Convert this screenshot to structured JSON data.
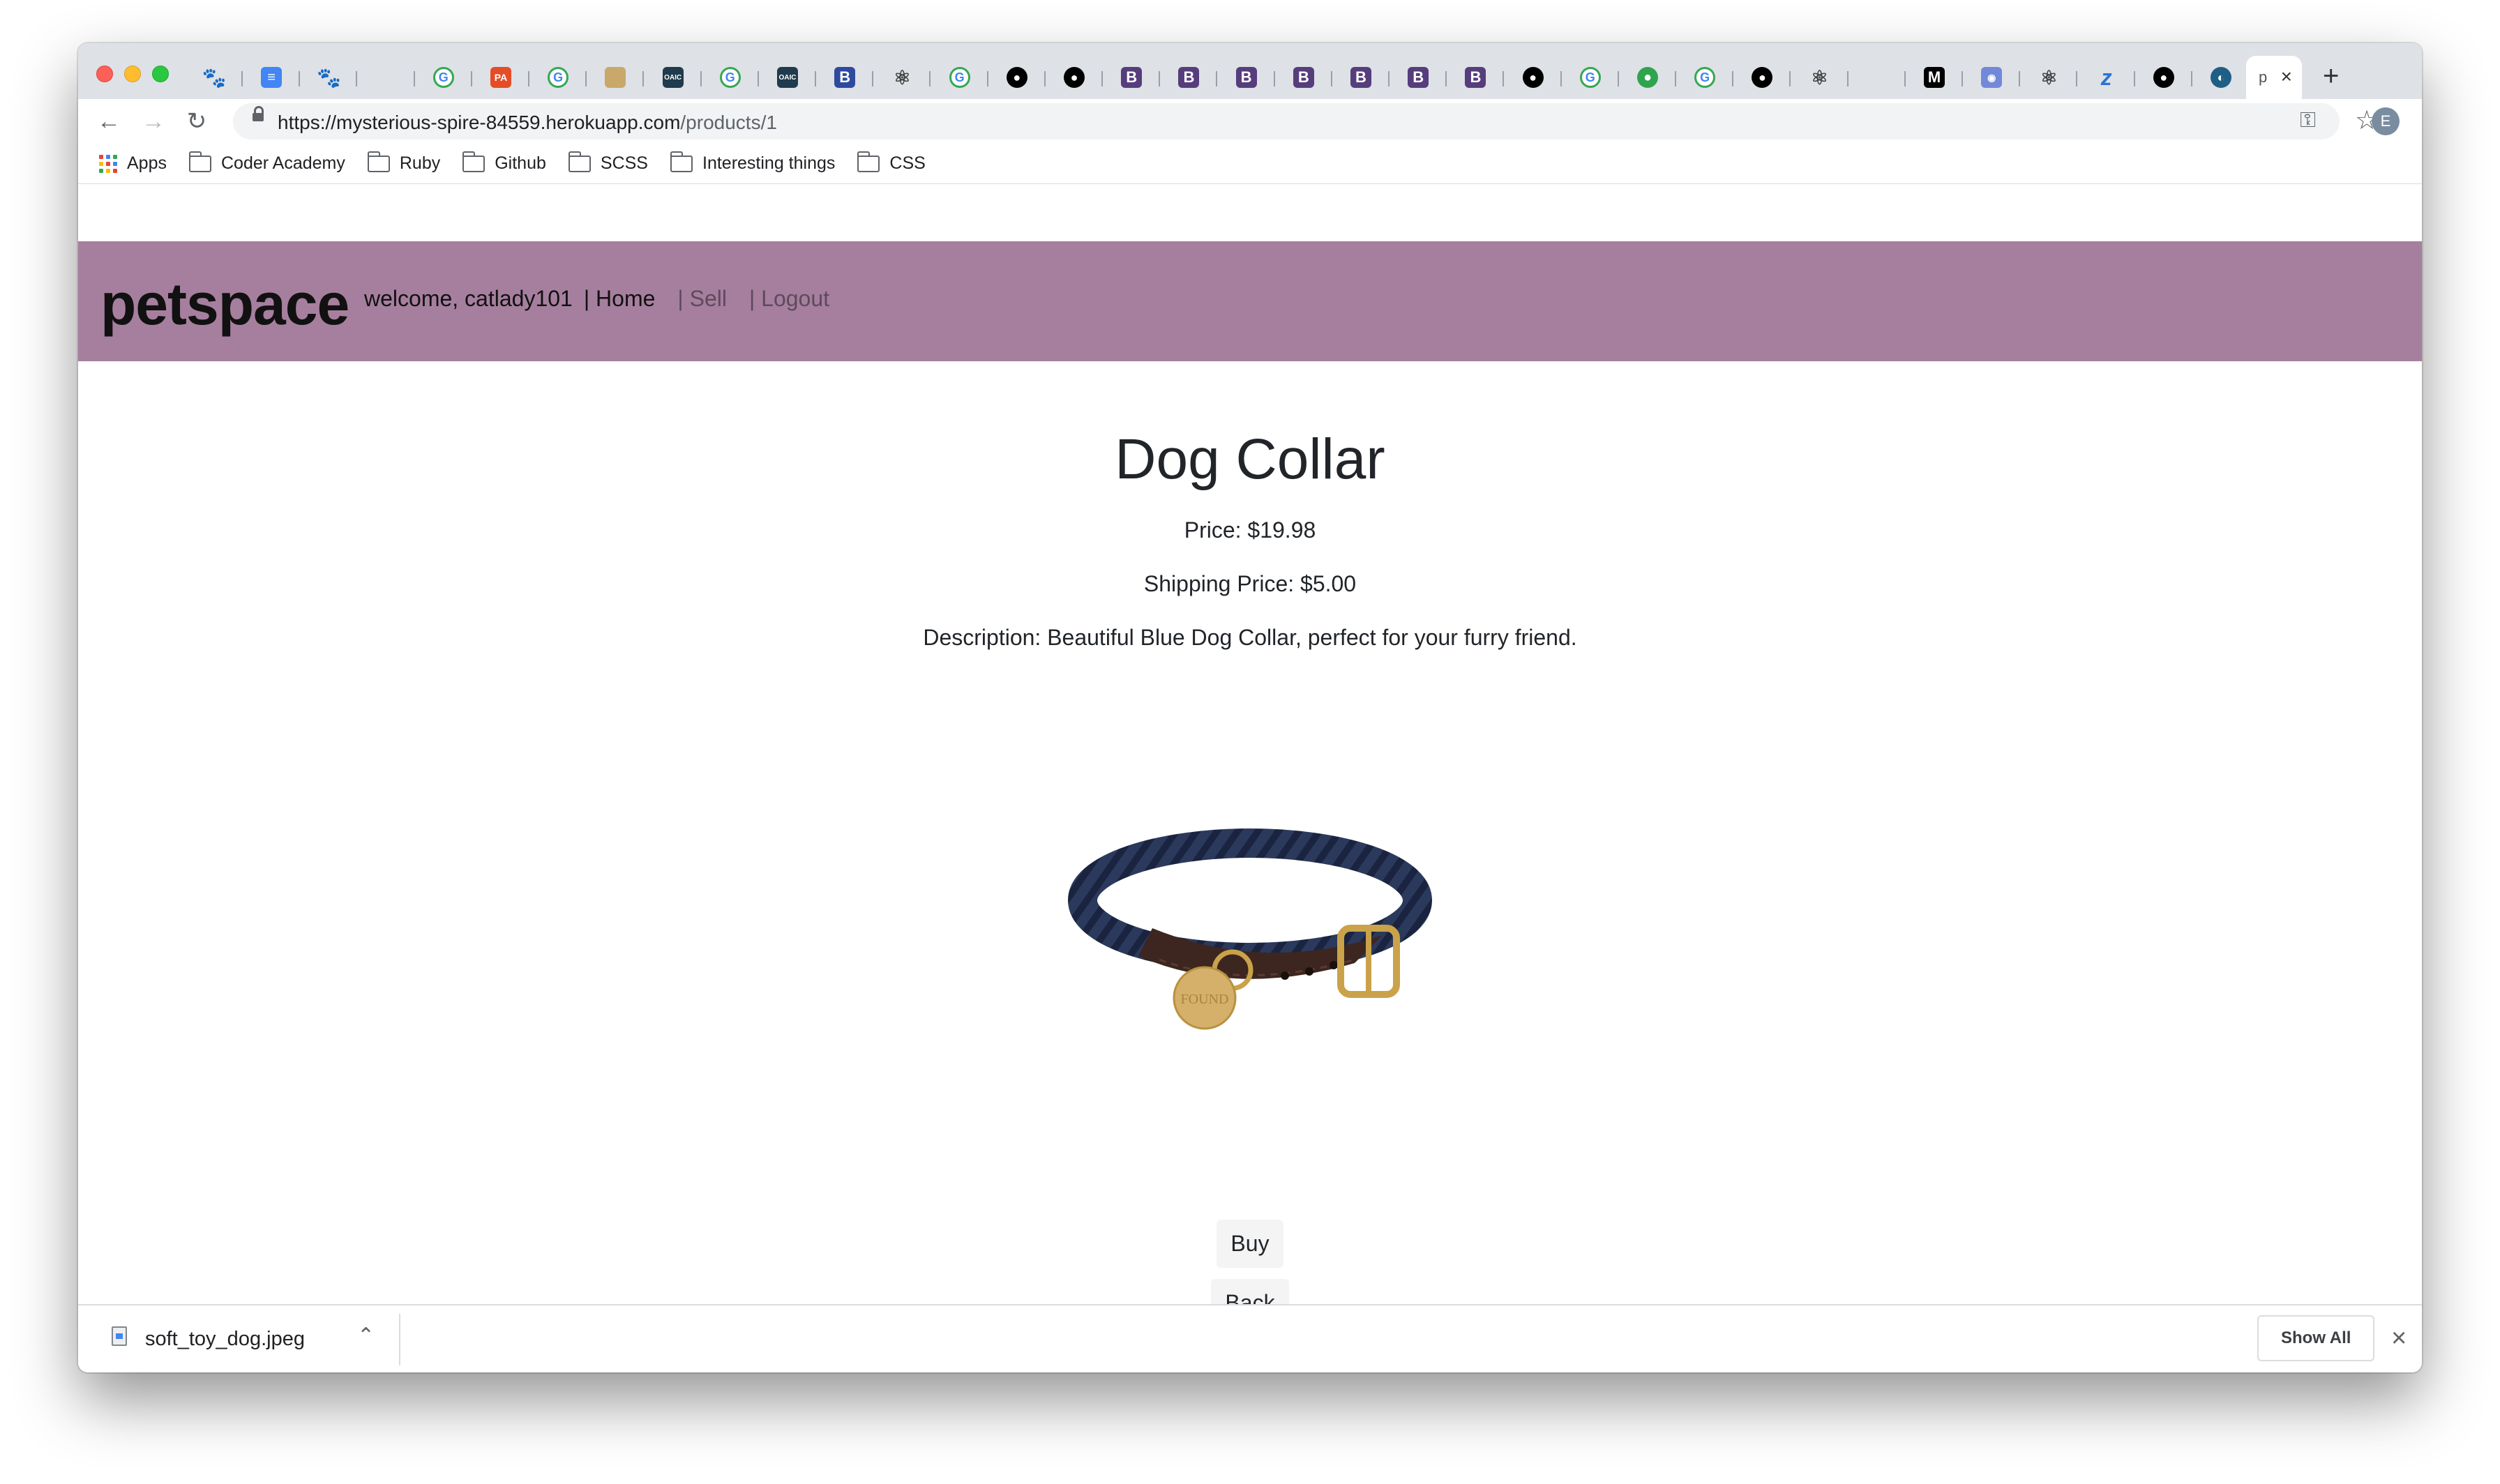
{
  "browser": {
    "tabs": [
      {
        "icon": "paw-icon",
        "glyph": "🐾",
        "style": "paw"
      },
      {
        "icon": "google-docs-icon",
        "glyph": "≡",
        "style": "doc"
      },
      {
        "icon": "paw-icon",
        "glyph": "🐾",
        "style": "paw"
      },
      {
        "icon": "page-icon",
        "glyph": "",
        "style": "page"
      },
      {
        "icon": "google-icon",
        "glyph": "G",
        "style": "g"
      },
      {
        "icon": "pa-icon",
        "glyph": "PA",
        "style": "pa"
      },
      {
        "icon": "google-icon",
        "glyph": "G",
        "style": "g"
      },
      {
        "icon": "site-icon",
        "glyph": "",
        "style": "dim"
      },
      {
        "icon": "oaic-icon",
        "glyph": "OAIC",
        "style": "oaic"
      },
      {
        "icon": "google-icon",
        "glyph": "G",
        "style": "g"
      },
      {
        "icon": "oaic-icon",
        "glyph": "OAIC",
        "style": "oaic"
      },
      {
        "icon": "bootstrap-icon",
        "glyph": "B",
        "style": "b2"
      },
      {
        "icon": "atom-icon",
        "glyph": "⚛",
        "style": "atom"
      },
      {
        "icon": "google-icon",
        "glyph": "G",
        "style": "g"
      },
      {
        "icon": "github-icon",
        "glyph": "●",
        "style": "gh"
      },
      {
        "icon": "github-icon",
        "glyph": "●",
        "style": "gh"
      },
      {
        "icon": "bootstrap-icon",
        "glyph": "B",
        "style": "b"
      },
      {
        "icon": "bootstrap-icon",
        "glyph": "B",
        "style": "b"
      },
      {
        "icon": "bootstrap-icon",
        "glyph": "B",
        "style": "b"
      },
      {
        "icon": "bootstrap-icon",
        "glyph": "B",
        "style": "b"
      },
      {
        "icon": "bootstrap-icon",
        "glyph": "B",
        "style": "b"
      },
      {
        "icon": "bootstrap-icon",
        "glyph": "B",
        "style": "b"
      },
      {
        "icon": "bootstrap-icon",
        "glyph": "B",
        "style": "b"
      },
      {
        "icon": "github-icon",
        "glyph": "●",
        "style": "gh"
      },
      {
        "icon": "google-icon",
        "glyph": "G",
        "style": "g"
      },
      {
        "icon": "green-circle-icon",
        "glyph": "●",
        "style": "green"
      },
      {
        "icon": "google-icon",
        "glyph": "G",
        "style": "g"
      },
      {
        "icon": "github-icon",
        "glyph": "●",
        "style": "gh"
      },
      {
        "icon": "atom-icon",
        "glyph": "⚛",
        "style": "atom"
      },
      {
        "icon": "page-icon",
        "glyph": "",
        "style": "page"
      },
      {
        "icon": "medium-icon",
        "glyph": "M",
        "style": "m"
      },
      {
        "icon": "discord-icon",
        "glyph": "◉",
        "style": "discord"
      },
      {
        "icon": "atom-icon",
        "glyph": "⚛",
        "style": "atom"
      },
      {
        "icon": "z-icon",
        "glyph": "z",
        "style": "z"
      },
      {
        "icon": "github-icon",
        "glyph": "●",
        "style": "gh"
      },
      {
        "icon": "circle-logo-icon",
        "glyph": "◐",
        "style": "circle"
      }
    ],
    "active_tab_letter": "p",
    "url_host": "https://mysterious-spire-84559.herokuapp.com",
    "url_path": "/products/1",
    "profile_initial": "E"
  },
  "bookmarks": [
    {
      "label": "Apps",
      "icon": "apps-grid-icon"
    },
    {
      "label": "Coder Academy",
      "icon": "folder-icon"
    },
    {
      "label": "Ruby",
      "icon": "folder-icon"
    },
    {
      "label": "Github",
      "icon": "folder-icon"
    },
    {
      "label": "SCSS",
      "icon": "folder-icon"
    },
    {
      "label": "Interesting things",
      "icon": "folder-icon"
    },
    {
      "label": "CSS",
      "icon": "folder-icon"
    }
  ],
  "site": {
    "brand": "petspace",
    "header_color": "#a67f9e",
    "welcome": "welcome, catlady101",
    "home_link": "| Home",
    "sell_link": "| Sell",
    "logout_link": "| Logout"
  },
  "product": {
    "title": "Dog Collar",
    "price": "Price: $19.98",
    "shipping": "Shipping Price: $5.00",
    "description": "Description: Beautiful Blue Dog Collar, perfect for your furry friend.",
    "image_alt": "FOUND",
    "buy_label": "Buy",
    "back_label": "Back"
  },
  "downloads": {
    "file_name": "soft_toy_dog.jpeg",
    "show_all_label": "Show All"
  }
}
